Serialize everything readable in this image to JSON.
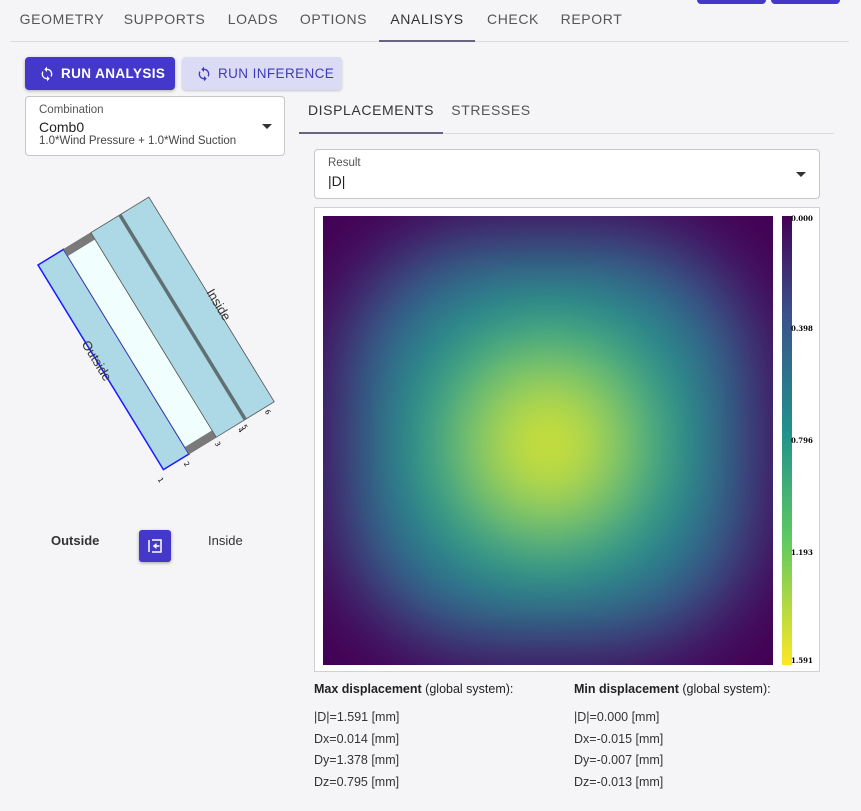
{
  "nav": {
    "tabs": [
      {
        "label": "GEOMETRY"
      },
      {
        "label": "SUPPORTS"
      },
      {
        "label": "LOADS"
      },
      {
        "label": "OPTIONS"
      },
      {
        "label": "ANALISYS"
      },
      {
        "label": "CHECK"
      },
      {
        "label": "REPORT"
      }
    ],
    "active_tab": "ANALISYS"
  },
  "actions": {
    "run_analysis_label": "RUN ANALYSIS",
    "run_inference_label": "RUN INFERENCE"
  },
  "combination": {
    "label": "Combination",
    "value": "Comb0",
    "description": "1.0*Wind Pressure + 1.0*Wind Suction"
  },
  "section": {
    "outside_label": "Outside",
    "inside_label": "Inside",
    "node_labels": [
      "1",
      "2",
      "3",
      "4",
      "5",
      "6"
    ]
  },
  "orientation": {
    "left_label": "Outside",
    "right_label": "Inside"
  },
  "result_tabs": {
    "tabs": [
      {
        "label": "DISPLACEMENTS"
      },
      {
        "label": "STRESSES"
      }
    ],
    "active_tab": "DISPLACEMENTS"
  },
  "result": {
    "label": "Result",
    "value": "|D|"
  },
  "colorbar": {
    "ticks": [
      "0.000",
      "0.398",
      "0.796",
      "1.193",
      "1.591"
    ],
    "colormap": "viridis (reversed)",
    "min": 0.0,
    "max": 1.591
  },
  "max_displacement": {
    "title": "Max displacement",
    "suffix": "(global system):",
    "D": "|D|=1.591 [mm]",
    "Dx": "Dx=0.014 [mm]",
    "Dy": "Dy=1.378 [mm]",
    "Dz": "Dz=0.795 [mm]"
  },
  "min_displacement": {
    "title": "Min displacement",
    "suffix": "(global system):",
    "D": "|D|=0.000 [mm]",
    "Dx": "Dx=-0.015 [mm]",
    "Dy": "Dy=-0.007 [mm]",
    "Dz": "Dz=-0.013 [mm]"
  },
  "colors": {
    "accent": "#4338ca",
    "glass": "#add8e6",
    "interlayer": "#f0fffe",
    "spacer": "#7a7a7a"
  }
}
